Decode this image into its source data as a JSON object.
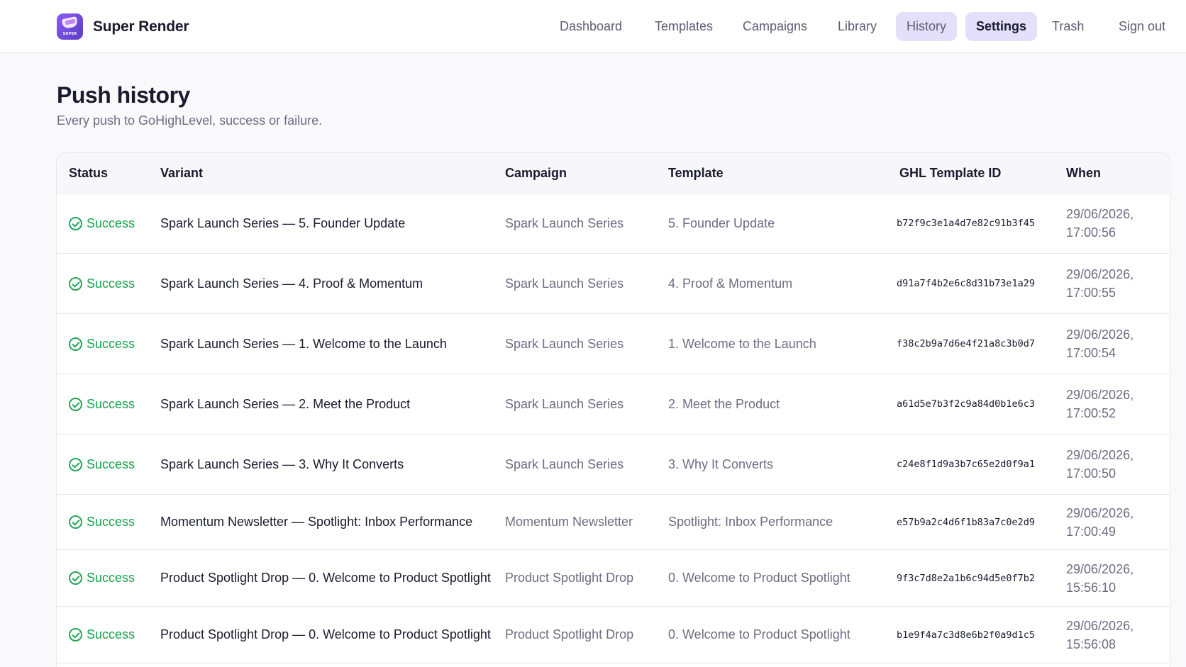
{
  "app": {
    "name": "Super Render",
    "logo_text": "SUPER"
  },
  "nav": {
    "items": [
      {
        "label": "Dashboard"
      },
      {
        "label": "Templates"
      },
      {
        "label": "Campaigns"
      },
      {
        "label": "Library"
      },
      {
        "label": "History",
        "state": "current"
      },
      {
        "label": "Settings",
        "state": "hover"
      },
      {
        "label": "Trash"
      },
      {
        "label": "Sign out"
      }
    ]
  },
  "page": {
    "title": "Push history",
    "subtitle": "Every push to GoHighLevel, success or failure."
  },
  "table": {
    "headers": {
      "status": "Status",
      "variant": "Variant",
      "campaign": "Campaign",
      "template": "Template",
      "ghl_id": "GHL Template ID",
      "when": "When"
    },
    "rows": [
      {
        "status": "Success",
        "variant": "Spark Launch Series — 5. Founder Update",
        "campaign": "Spark Launch Series",
        "template": "5. Founder Update",
        "ghl_id": "b72f9c3e1a4d7e82c91b3f45",
        "when": "29/06/2026, 17:00:56"
      },
      {
        "status": "Success",
        "variant": "Spark Launch Series — 4. Proof & Momentum",
        "campaign": "Spark Launch Series",
        "template": "4. Proof & Momentum",
        "ghl_id": "d91a7f4b2e6c8d31b73e1a29",
        "when": "29/06/2026, 17:00:55"
      },
      {
        "status": "Success",
        "variant": "Spark Launch Series — 1. Welcome to the Launch",
        "campaign": "Spark Launch Series",
        "template": "1. Welcome to the Launch",
        "ghl_id": "f38c2b9a7d6e4f21a8c3b0d7",
        "when": "29/06/2026, 17:00:54"
      },
      {
        "status": "Success",
        "variant": "Spark Launch Series — 2. Meet the Product",
        "campaign": "Spark Launch Series",
        "template": "2. Meet the Product",
        "ghl_id": "a61d5e7b3f2c9a84d0b1e6c3",
        "when": "29/06/2026, 17:00:52"
      },
      {
        "status": "Success",
        "variant": "Spark Launch Series — 3. Why It Converts",
        "campaign": "Spark Launch Series",
        "template": "3. Why It Converts",
        "ghl_id": "c24e8f1d9a3b7c65e2d0f9a1",
        "when": "29/06/2026, 17:00:50"
      },
      {
        "status": "Success",
        "variant": "Momentum Newsletter — Spotlight: Inbox Performance",
        "campaign": "Momentum Newsletter",
        "template": "Spotlight: Inbox Performance",
        "ghl_id": "e57b9a2c4d6f1b83a7c0e2d9",
        "when": "29/06/2026, 17:00:49"
      },
      {
        "status": "Success",
        "variant": "Product Spotlight Drop — 0. Welcome to Product Spotlight",
        "campaign": "Product Spotlight Drop",
        "template": "0. Welcome to Product Spotlight",
        "ghl_id": "9f3c7d8e2a1b6c94d5e0f7b2",
        "when": "29/06/2026, 15:56:10"
      },
      {
        "status": "Success",
        "variant": "Product Spotlight Drop — 0. Welcome to Product Spotlight",
        "campaign": "Product Spotlight Drop",
        "template": "0. Welcome to Product Spotlight",
        "ghl_id": "b1e9f4a7c3d8e6b2f0a9d1c5",
        "when": "29/06/2026, 15:56:08"
      }
    ]
  },
  "colors": {
    "accent": "#e4e0fb",
    "success": "#16a34a",
    "text_primary": "#1a1b2e",
    "text_muted": "#6b6d82"
  }
}
